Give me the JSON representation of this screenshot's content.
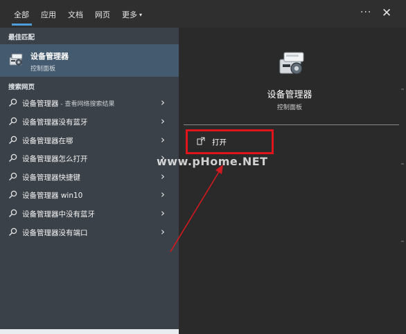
{
  "tabs": [
    {
      "label": "全部",
      "selected": true
    },
    {
      "label": "应用",
      "selected": false
    },
    {
      "label": "文档",
      "selected": false
    },
    {
      "label": "网页",
      "selected": false
    },
    {
      "label": "更多",
      "selected": false,
      "caret": "▾"
    }
  ],
  "topbar": {
    "more_options": "···",
    "close": "✕"
  },
  "left": {
    "best_match_heading": "最佳匹配",
    "best_match": {
      "title": "设备管理器",
      "subtitle": "控制面板",
      "icon": "device-manager-icon"
    },
    "search_web_heading": "搜索网页",
    "results": [
      {
        "text": "设备管理器",
        "suffix": " - 查看网络搜索结果"
      },
      {
        "text": "设备管理器没有蓝牙",
        "suffix": ""
      },
      {
        "text": "设备管理器在哪",
        "suffix": ""
      },
      {
        "text": "设备管理器怎么打开",
        "suffix": ""
      },
      {
        "text": "设备管理器快捷键",
        "suffix": ""
      },
      {
        "text": "设备管理器 win10",
        "suffix": ""
      },
      {
        "text": "设备管理器中没有蓝牙",
        "suffix": ""
      },
      {
        "text": "设备管理器没有端口",
        "suffix": ""
      }
    ],
    "chevron": "›"
  },
  "right": {
    "title": "设备管理器",
    "subtitle": "控制面板",
    "open_label": "打开"
  },
  "watermark": "www.pHome.NET",
  "colors": {
    "accent": "#4f9fdc",
    "highlight": "#e0141a",
    "selected_row": "#445a6e"
  }
}
